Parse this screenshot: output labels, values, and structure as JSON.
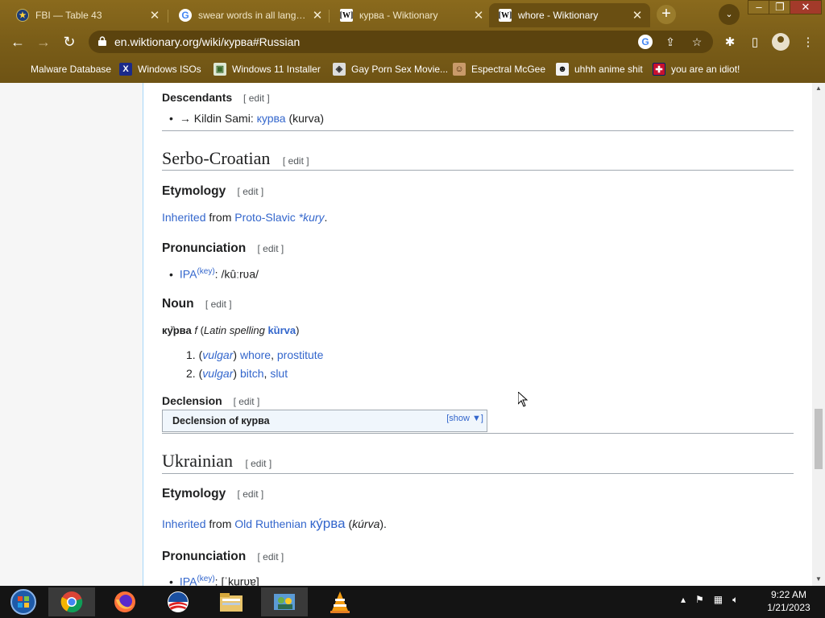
{
  "tabs": [
    {
      "title": "FBI — Table 43",
      "favicon": "fbi-seal-icon"
    },
    {
      "title": "swear words in all languages",
      "favicon": "google-icon"
    },
    {
      "title": "курва - Wiktionary",
      "favicon": "wiktionary-icon"
    },
    {
      "title": "whore - Wiktionary",
      "favicon": "wiktionary-icon",
      "active": true
    }
  ],
  "address_bar": {
    "url": "en.wiktionary.org/wiki/курва#Russian"
  },
  "bookmarks": [
    {
      "label": "Malware Database"
    },
    {
      "label": "Windows ISOs"
    },
    {
      "label": "Windows 11 Installer"
    },
    {
      "label": "Gay Porn Sex Movie..."
    },
    {
      "label": "Espectral McGee"
    },
    {
      "label": "uhhh anime shit"
    },
    {
      "label": "you are an idiot!"
    }
  ],
  "page": {
    "edit_label": "[ edit ]",
    "descendants": {
      "heading": "Descendants",
      "arrow": "→ Kildin Sami: ",
      "word": "курва",
      "translit": " (kurva)"
    },
    "serbo": {
      "heading": "Serbo-Croatian",
      "etymology_heading": "Etymology",
      "ety_inherited": "Inherited",
      "ety_from": " from ",
      "ety_lang": "Proto-Slavic",
      "ety_word": "*kury",
      "ety_end": ".",
      "pron_heading": "Pronunciation",
      "ipa": "IPA",
      "ipa_key": "(key)",
      "ipa_value": ": /kûːrʋa/",
      "noun_heading": "Noun",
      "headword": "ку̏рва",
      "gender": " f",
      "latin_open": " (",
      "latin_label": "Latin spelling",
      "latin_word": "kȕrva",
      "latin_close": ")",
      "senses": [
        {
          "num": "1.",
          "label": "vulgar",
          "gloss1": "whore",
          "sep": ", ",
          "gloss2": "prostitute"
        },
        {
          "num": "2.",
          "label": "vulgar",
          "gloss1": "bitch",
          "sep": ", ",
          "gloss2": "slut"
        }
      ],
      "declension_heading": "Declension",
      "declension_box_title": "Declension of курва",
      "declension_show": "[show ▼]"
    },
    "ukrainian": {
      "heading": "Ukrainian",
      "etymology_heading": "Etymology",
      "ety_inherited": "Inherited",
      "ety_from": " from ",
      "ety_lang": "Old Ruthenian",
      "ety_word": "ку́рва",
      "ety_translit": "kúrva",
      "pron_heading": "Pronunciation",
      "ipa": "IPA",
      "ipa_key": "(key)",
      "ipa_value": ": [ˈkurʋɐ]"
    }
  },
  "taskbar": {
    "apps": [
      "start-orb-icon",
      "chrome-icon",
      "firefox-icon",
      "obama-logo-icon",
      "file-explorer-icon",
      "network-people-icon",
      "vlc-icon"
    ],
    "time": "9:22 AM",
    "date": "1/21/2023"
  }
}
